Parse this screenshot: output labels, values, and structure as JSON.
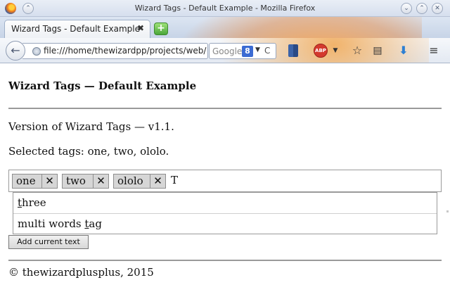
{
  "window": {
    "title": "Wizard Tags - Default Example - Mozilla Firefox",
    "min_glyph": "⌄",
    "max_glyph": "⌃",
    "close_glyph": "✕",
    "sys_glyph": "⌃"
  },
  "tabs": [
    {
      "label": "Wizard Tags - Default Example",
      "close": "✖"
    }
  ],
  "newtab_label": "+",
  "navbar": {
    "back_glyph": "←",
    "url": "file:///home/thewizardpp/projects/web/wizard-tags/index.html",
    "search_placeholder": "Google",
    "search_engine_glyph": "8",
    "dropdown_glyph": "▼",
    "reload_glyph": "C",
    "abp_label": "ABP",
    "star_glyph": "☆",
    "reader_glyph": "▤",
    "download_glyph": "⬇",
    "menu_glyph": "≡"
  },
  "page": {
    "title": "Wizard Tags — Default Example",
    "version": "Version of Wizard Tags — v1.1.",
    "selected": "Selected tags: one, two, ololo.",
    "tags": [
      {
        "label": "one",
        "remove": "✕"
      },
      {
        "label": "two",
        "remove": "✕"
      },
      {
        "label": "ololo",
        "remove": "✕"
      }
    ],
    "input_text": "T",
    "suggestions": [
      {
        "before": "",
        "match": "t",
        "after": "hree"
      },
      {
        "before": "multi words ",
        "match": "t",
        "after": "ag"
      }
    ],
    "add_button": "Add current text",
    "footer": "© thewizardplusplus, 2015"
  }
}
